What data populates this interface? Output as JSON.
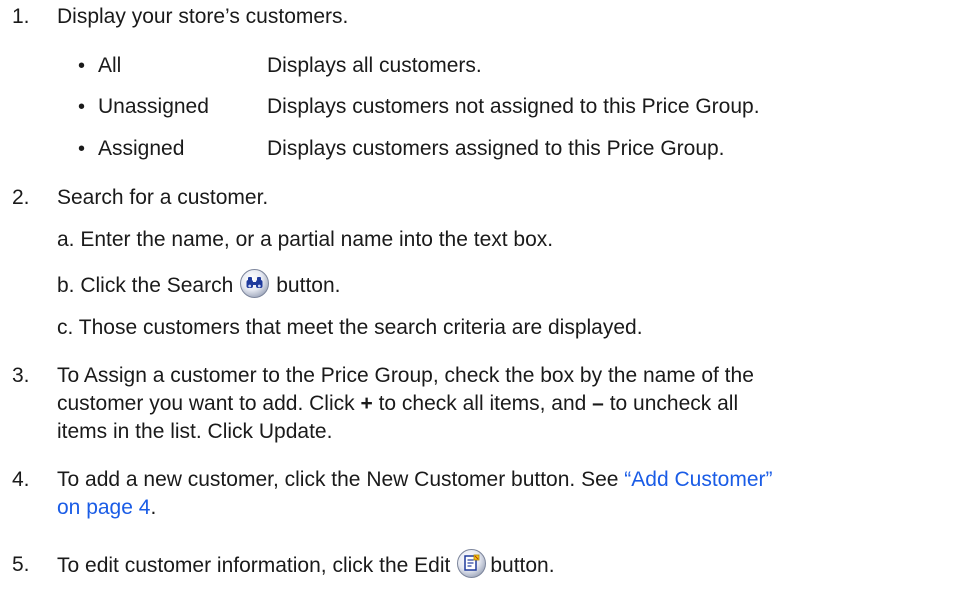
{
  "steps": {
    "s1": {
      "num": "1.",
      "text": "Display your store’s customers."
    },
    "filters": [
      {
        "bullet": "•",
        "term": "All",
        "desc": "Displays all customers."
      },
      {
        "bullet": "•",
        "term": "Unassigned",
        "desc": "Displays customers not assigned to this Price Group."
      },
      {
        "bullet": "•",
        "term": "Assigned",
        "desc": "Displays customers assigned to this Price Group."
      }
    ],
    "s2": {
      "num": "2.",
      "text": "Search for a customer.",
      "a": "a. Enter the name, or a partial name into the text box.",
      "b_before": "b. Click the Search",
      "b_after": "button.",
      "c": "c. Those customers that meet the search criteria are displayed."
    },
    "s3": {
      "num": "3.",
      "line1": "To Assign a customer to the Price Group, check the box by the name of the",
      "line2_a": "customer you want to add. Click ",
      "plus": "+",
      "line2_b": " to check all items, and ",
      "minus": "–",
      "line2_c": " to uncheck all",
      "line3": "items in the list. Click Update."
    },
    "s4": {
      "num": "4.",
      "line1": "To add a new customer, click the New Customer button. See ",
      "link1": "“Add Customer”",
      "link2": "on page 4",
      "period": "."
    },
    "s5": {
      "num": "5.",
      "before": "To edit customer information, click the Edit",
      "after": "button."
    },
    "icons": {
      "search": "binoculars-icon",
      "edit": "edit-document-icon"
    },
    "colors": {
      "link": "#1a5ce6",
      "text": "#1a1a1a"
    }
  }
}
